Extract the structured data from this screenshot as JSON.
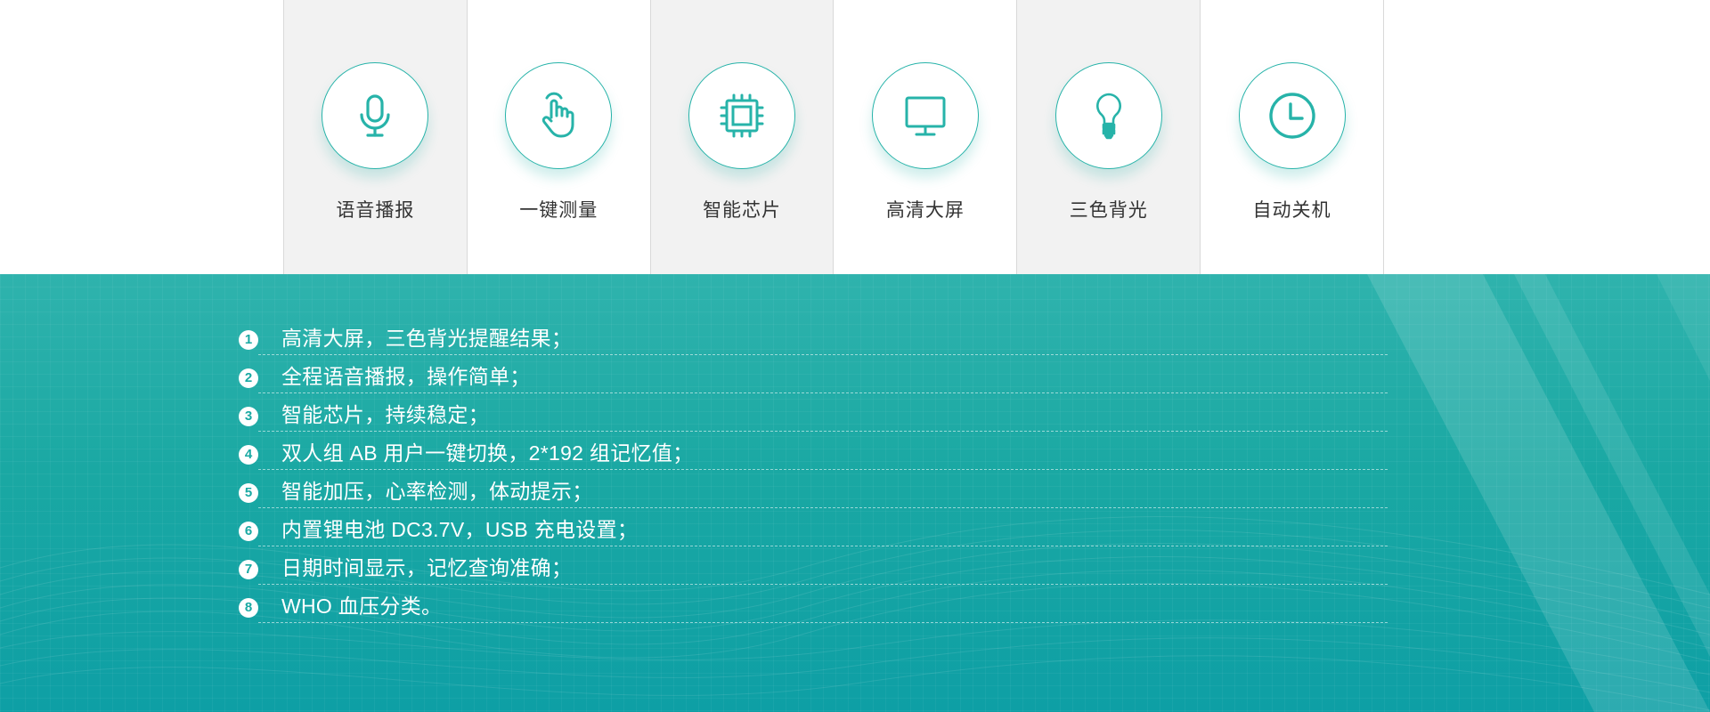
{
  "colors": {
    "accent": "#27b3a9",
    "panel_top": "#2fb3ad",
    "panel_bottom": "#0e9fa5",
    "feature_shade": "#f2f2f2",
    "label_text": "#333333"
  },
  "features": [
    {
      "label": "语音播报",
      "icon": "microphone-icon"
    },
    {
      "label": "一键测量",
      "icon": "hand-pointer-icon"
    },
    {
      "label": "智能芯片",
      "icon": "chip-icon"
    },
    {
      "label": "高清大屏",
      "icon": "monitor-icon"
    },
    {
      "label": "三色背光",
      "icon": "lightbulb-icon"
    },
    {
      "label": "自动关机",
      "icon": "clock-icon"
    }
  ],
  "specs": [
    {
      "num": "1",
      "text": "高清大屏，三色背光提醒结果；"
    },
    {
      "num": "2",
      "text": "全程语音播报，操作简单；"
    },
    {
      "num": "3",
      "text": "智能芯片，持续稳定；"
    },
    {
      "num": "4",
      "text": "双人组 AB 用户一键切换，2*192 组记忆值；"
    },
    {
      "num": "5",
      "text": "智能加压，心率检测，体动提示；"
    },
    {
      "num": "6",
      "text": "内置锂电池 DC3.7V，USB 充电设置；"
    },
    {
      "num": "7",
      "text": "日期时间显示，记忆查询准确；"
    },
    {
      "num": "8",
      "text": "WHO 血压分类。"
    }
  ]
}
